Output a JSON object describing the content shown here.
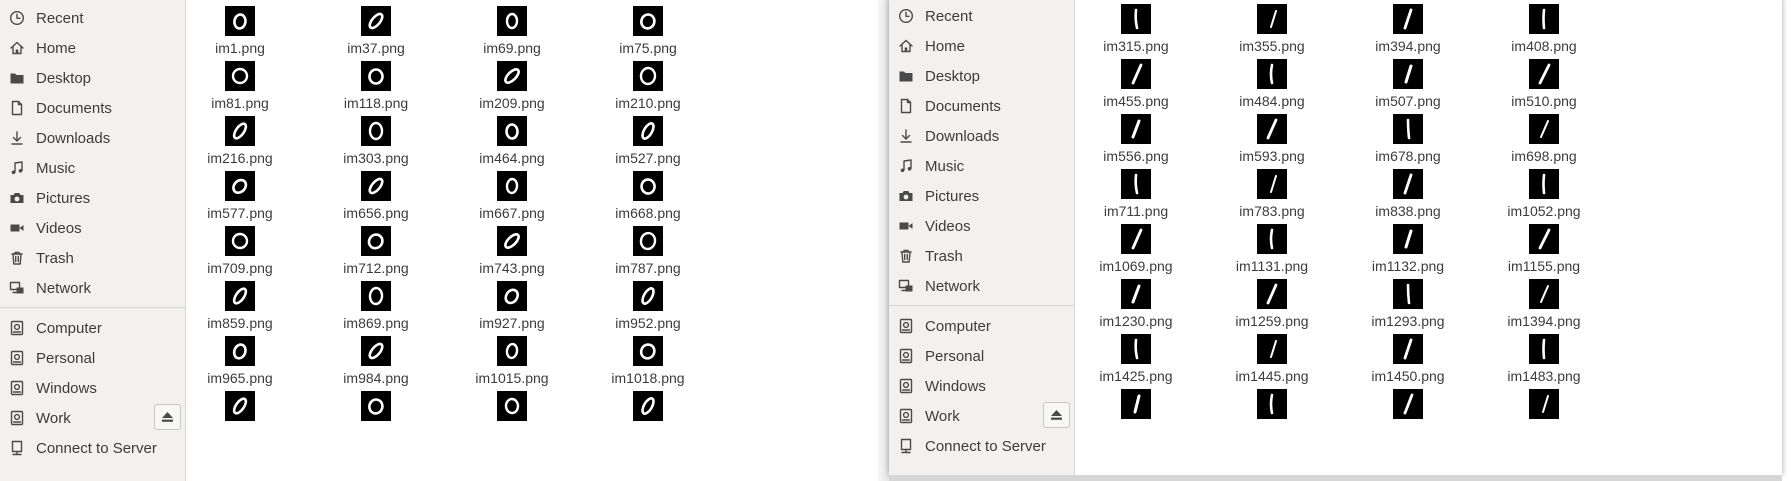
{
  "left_window": {
    "sidebar": {
      "places": [
        {
          "label": "Recent",
          "icon": "clock-icon"
        },
        {
          "label": "Home",
          "icon": "home-icon"
        },
        {
          "label": "Desktop",
          "icon": "folder-icon"
        },
        {
          "label": "Documents",
          "icon": "document-icon"
        },
        {
          "label": "Downloads",
          "icon": "download-icon"
        },
        {
          "label": "Music",
          "icon": "music-icon"
        },
        {
          "label": "Pictures",
          "icon": "camera-icon"
        },
        {
          "label": "Videos",
          "icon": "video-icon"
        },
        {
          "label": "Trash",
          "icon": "trash-icon"
        },
        {
          "label": "Network",
          "icon": "network-icon"
        }
      ],
      "devices": [
        {
          "label": "Computer",
          "icon": "drive-icon"
        },
        {
          "label": "Personal",
          "icon": "drive-icon"
        },
        {
          "label": "Windows",
          "icon": "drive-icon"
        },
        {
          "label": "Work",
          "icon": "drive-icon",
          "eject": true
        },
        {
          "label": "Connect to Server",
          "icon": "server-icon"
        }
      ]
    },
    "files": [
      [
        "im1.png",
        "im37.png",
        "im69.png",
        "im75.png"
      ],
      [
        "im81.png",
        "im118.png",
        "im209.png",
        "im210.png"
      ],
      [
        "im216.png",
        "im303.png",
        "im464.png",
        "im527.png"
      ],
      [
        "im577.png",
        "im656.png",
        "im667.png",
        "im668.png"
      ],
      [
        "im709.png",
        "im712.png",
        "im743.png",
        "im787.png"
      ],
      [
        "im859.png",
        "im869.png",
        "im927.png",
        "im952.png"
      ],
      [
        "im965.png",
        "im984.png",
        "im1015.png",
        "im1018.png"
      ]
    ],
    "partial_row_glyph": "zero-digit-icon"
  },
  "right_window": {
    "sidebar": {
      "places": [
        {
          "label": "Recent",
          "icon": "clock-icon"
        },
        {
          "label": "Home",
          "icon": "home-icon"
        },
        {
          "label": "Desktop",
          "icon": "folder-icon"
        },
        {
          "label": "Documents",
          "icon": "document-icon"
        },
        {
          "label": "Downloads",
          "icon": "download-icon"
        },
        {
          "label": "Music",
          "icon": "music-icon"
        },
        {
          "label": "Pictures",
          "icon": "camera-icon"
        },
        {
          "label": "Videos",
          "icon": "video-icon"
        },
        {
          "label": "Trash",
          "icon": "trash-icon"
        },
        {
          "label": "Network",
          "icon": "network-icon"
        }
      ],
      "devices": [
        {
          "label": "Computer",
          "icon": "drive-icon"
        },
        {
          "label": "Personal",
          "icon": "drive-icon"
        },
        {
          "label": "Windows",
          "icon": "drive-icon"
        },
        {
          "label": "Work",
          "icon": "drive-icon",
          "eject": true
        },
        {
          "label": "Connect to Server",
          "icon": "server-icon"
        }
      ]
    },
    "files": [
      [
        "im315.png",
        "im355.png",
        "im394.png",
        "im408.png"
      ],
      [
        "im455.png",
        "im484.png",
        "im507.png",
        "im510.png"
      ],
      [
        "im556.png",
        "im593.png",
        "im678.png",
        "im698.png"
      ],
      [
        "im711.png",
        "im783.png",
        "im838.png",
        "im1052.png"
      ],
      [
        "im1069.png",
        "im1131.png",
        "im1132.png",
        "im1155.png"
      ],
      [
        "im1230.png",
        "im1259.png",
        "im1293.png",
        "im1394.png"
      ],
      [
        "im1425.png",
        "im1445.png",
        "im1450.png",
        "im1483.png"
      ]
    ],
    "partial_row_glyph": "one-digit-icon"
  }
}
